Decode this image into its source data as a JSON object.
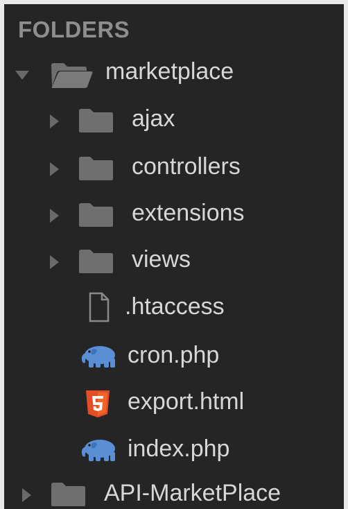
{
  "sidebar": {
    "header": "FOLDERS",
    "tree": [
      {
        "label": "marketplace",
        "type": "folder-open",
        "expanded": true
      },
      {
        "label": "ajax",
        "type": "folder"
      },
      {
        "label": "controllers",
        "type": "folder"
      },
      {
        "label": "extensions",
        "type": "folder"
      },
      {
        "label": "views",
        "type": "folder"
      },
      {
        "label": ".htaccess",
        "type": "file",
        "icon": "file-icon"
      },
      {
        "label": "cron.php",
        "type": "file",
        "icon": "php-elephant-icon"
      },
      {
        "label": "export.html",
        "type": "file",
        "icon": "html5-icon"
      },
      {
        "label": "index.php",
        "type": "file",
        "icon": "php-elephant-icon"
      },
      {
        "label": "API-MarketPlace",
        "type": "folder"
      }
    ]
  },
  "colors": {
    "background": "#252526",
    "text": "#d7d7d7",
    "folder": "#6f6f6f",
    "php": "#5a8fd6",
    "html5": "#e44d26",
    "arrow": "#6a6a6a"
  }
}
